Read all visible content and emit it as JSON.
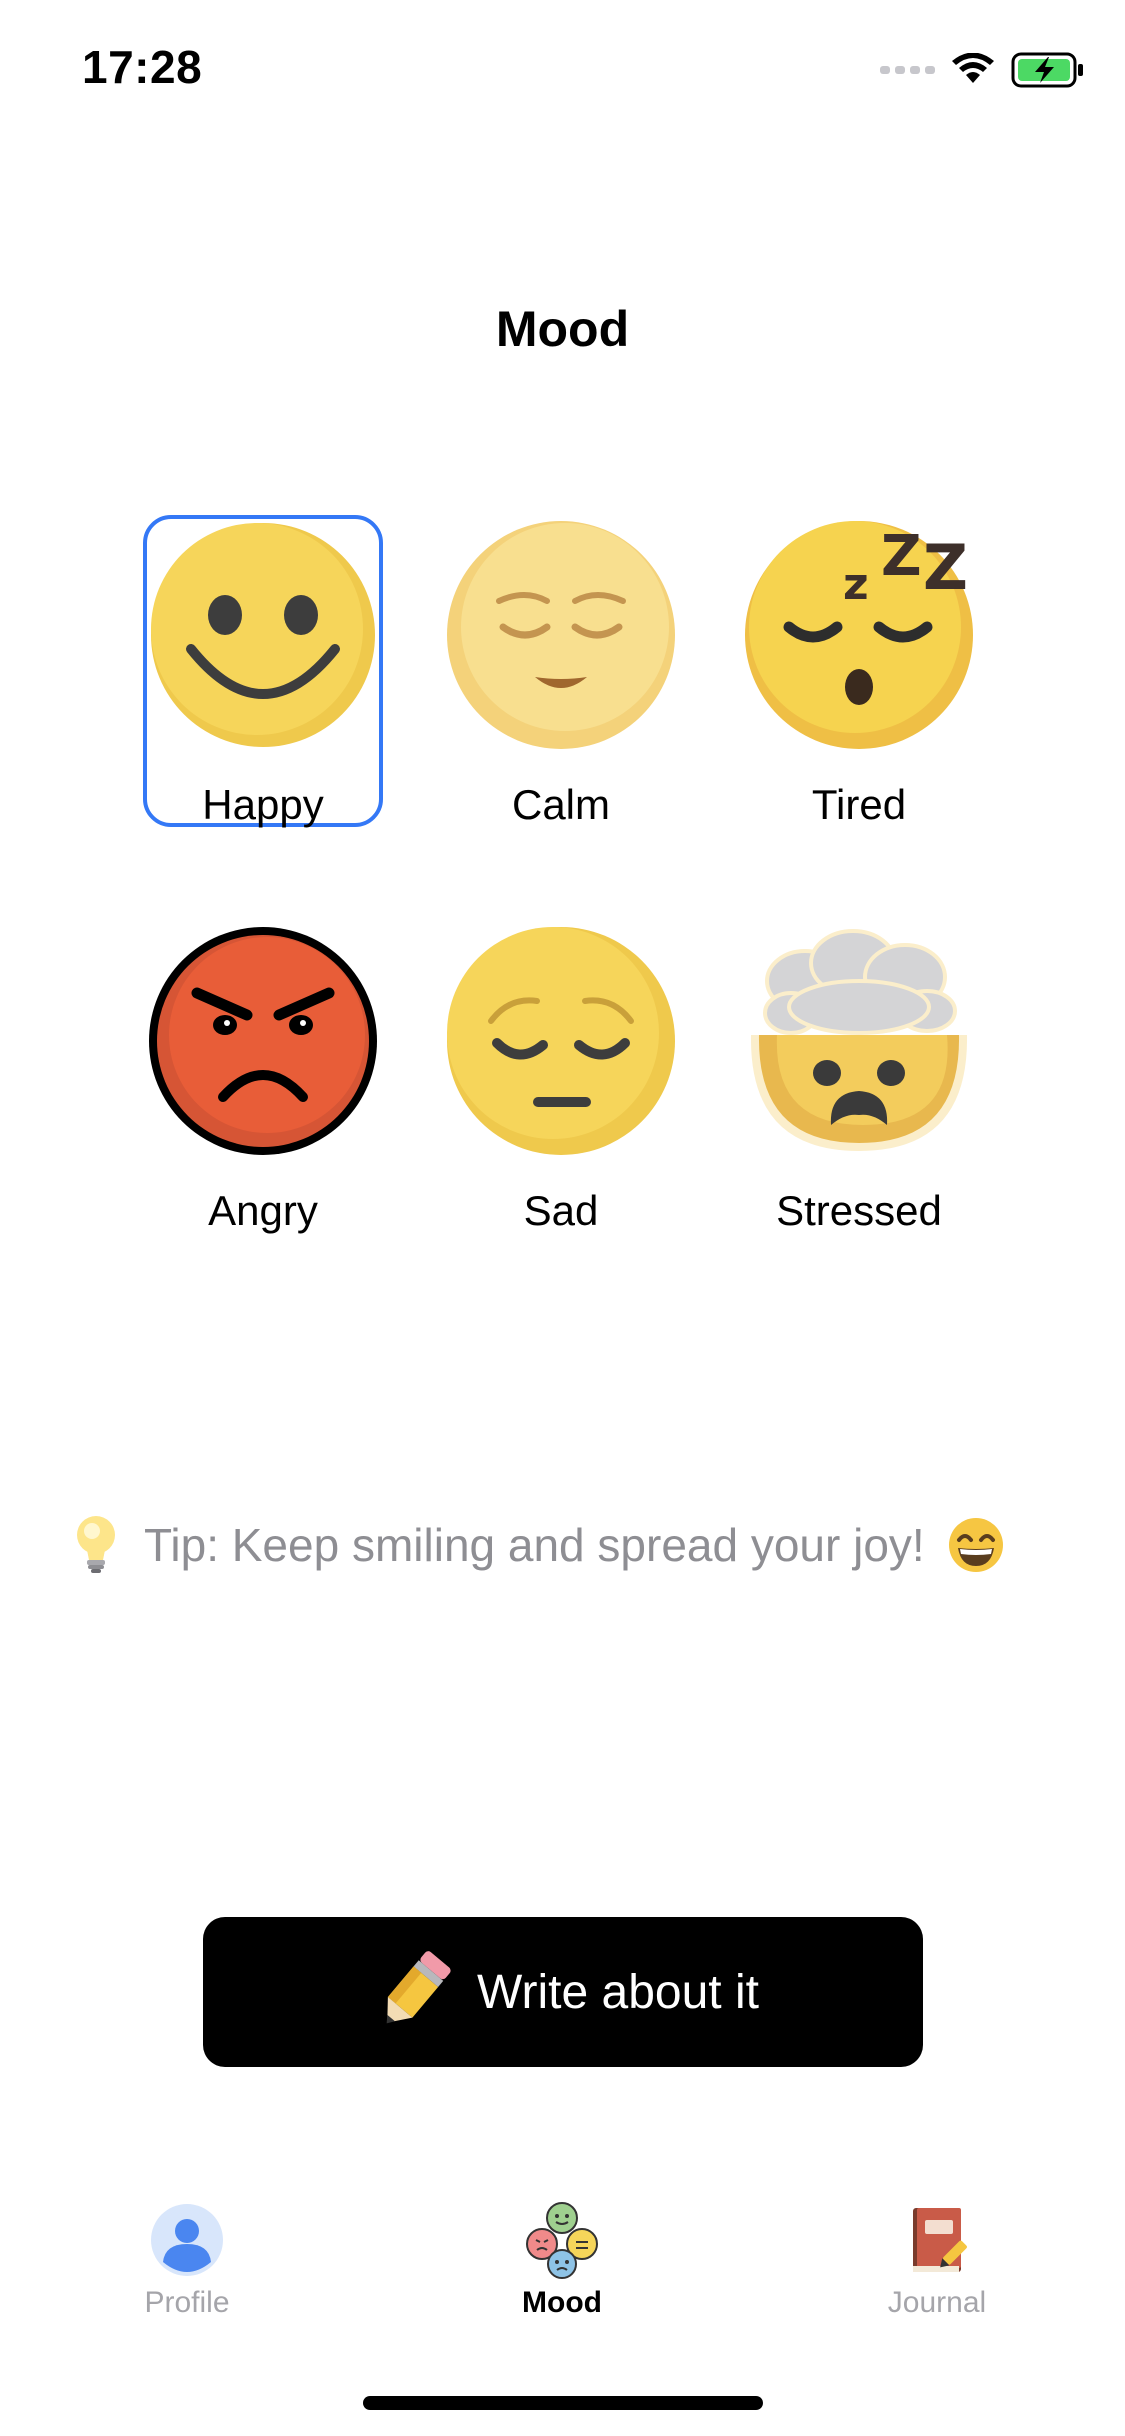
{
  "status_bar": {
    "time": "17:28",
    "icons": [
      "cellular-signal-icon",
      "wifi-icon",
      "battery-charging-icon"
    ]
  },
  "page": {
    "title": "Mood"
  },
  "moods": [
    {
      "label": "Happy",
      "icon": "happy-face-icon",
      "selected": true
    },
    {
      "label": "Calm",
      "icon": "calm-face-icon",
      "selected": false
    },
    {
      "label": "Tired",
      "icon": "sleeping-face-icon",
      "selected": false
    },
    {
      "label": "Angry",
      "icon": "angry-face-icon",
      "selected": false
    },
    {
      "label": "Sad",
      "icon": "pensive-face-icon",
      "selected": false
    },
    {
      "label": "Stressed",
      "icon": "exploding-head-icon",
      "selected": false
    }
  ],
  "tip": {
    "icon": "lightbulb-icon",
    "text": "Tip: Keep smiling and spread your joy!",
    "trailing_icon": "grinning-face-icon"
  },
  "write_button": {
    "icon": "pencil-icon",
    "label": "Write about it"
  },
  "tabs": [
    {
      "label": "Profile",
      "icon": "profile-icon",
      "active": false
    },
    {
      "label": "Mood",
      "icon": "mood-icon",
      "active": true
    },
    {
      "label": "Journal",
      "icon": "journal-icon",
      "active": false
    }
  ],
  "colors": {
    "selection_border": "#3478f6",
    "tip_text": "#8e8e93",
    "button_bg": "#000000",
    "tab_inactive": "#a5a5aa"
  }
}
